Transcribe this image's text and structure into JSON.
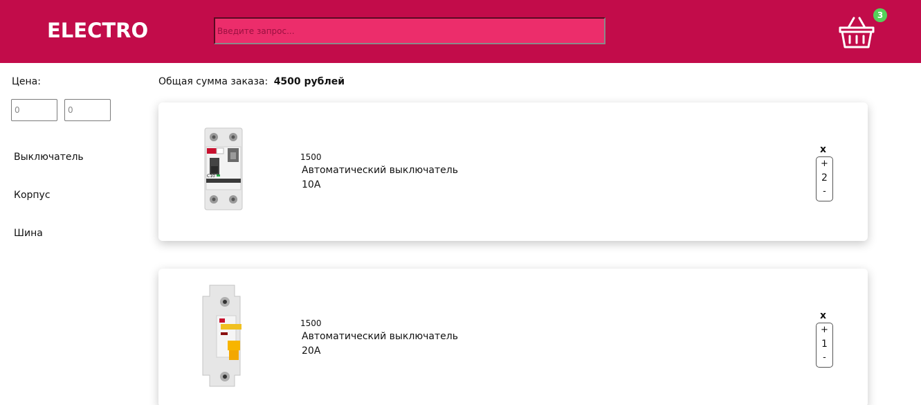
{
  "header": {
    "logo": "ELECTRO",
    "search_placeholder": "Введите запрос...",
    "cart_count": "3",
    "brand_color": "#c20c4a"
  },
  "sidebar": {
    "price_label": "Цена:",
    "price_min_placeholder": "0",
    "price_max_placeholder": "0",
    "categories": [
      "Выключатель",
      "Корпус",
      "Шина"
    ]
  },
  "order": {
    "total_label": "Общая сумма заказа:",
    "total_value": "4500 рублей"
  },
  "items": [
    {
      "price": "1500",
      "name_line1": "Автоматический выключатель",
      "name_line2": "10А",
      "remove_label": "x",
      "plus": "+",
      "quantity": "2",
      "minus": "-",
      "icon": "circuit-breaker-rcbo-icon"
    },
    {
      "price": "1500",
      "name_line1": "Автоматический выключатель",
      "name_line2": "20А",
      "remove_label": "x",
      "plus": "+",
      "quantity": "1",
      "minus": "-",
      "icon": "circuit-breaker-icon"
    }
  ]
}
